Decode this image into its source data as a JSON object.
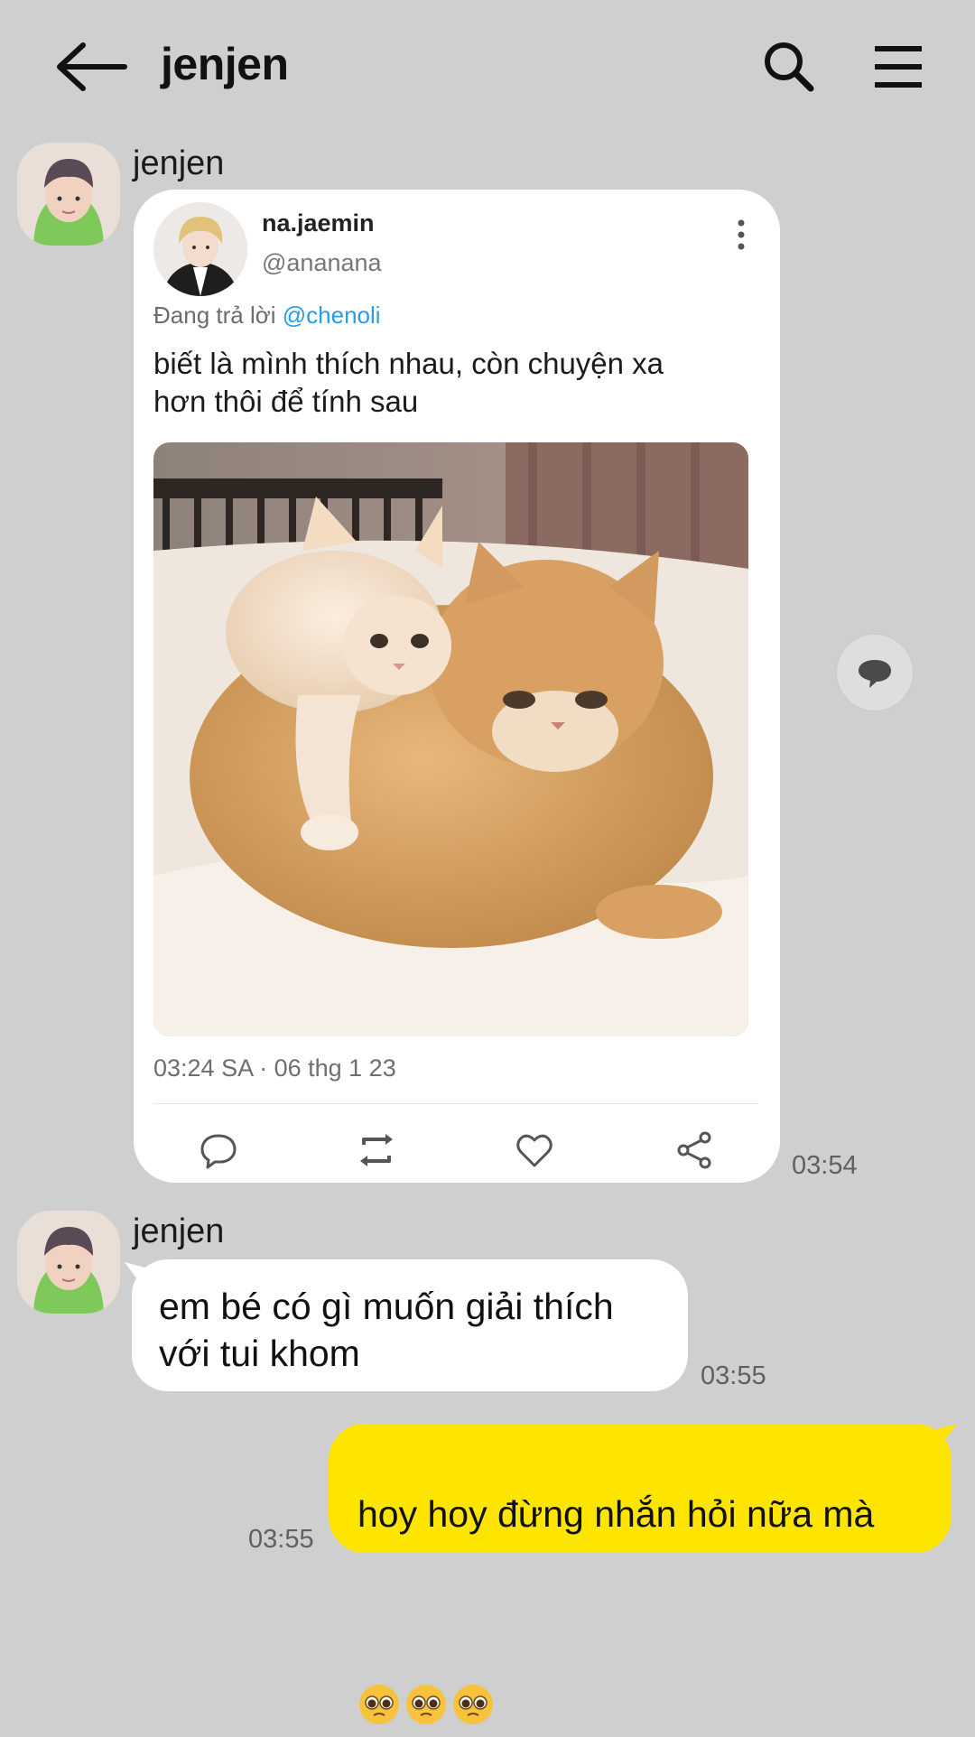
{
  "header": {
    "title": "jenjen",
    "icons": [
      "back-arrow-icon",
      "search-icon",
      "hamburger-menu-icon"
    ]
  },
  "messages": [
    {
      "sender": "jenjen",
      "time": "03:54",
      "tweet": {
        "name": "na.jaemin",
        "handle": "@ananana",
        "reply_prefix": "Đang trả lời ",
        "reply_to": "@chenoli",
        "text_line1": "biết là mình thích nhau, còn chuyện xa",
        "text_line2": "hơn thôi để tính sau",
        "timestamp": "03:24 SA · 06 thg 1 23",
        "actions": [
          "reply-icon",
          "retweet-icon",
          "like-icon",
          "share-icon"
        ]
      }
    },
    {
      "sender": "jenjen",
      "time": "03:55",
      "text_line1": "em bé có gì muốn giải thích",
      "text_line2": "với tui khom"
    },
    {
      "sender": "me",
      "time": "03:55",
      "text": "hoy hoy đừng nhắn hỏi nữa mà",
      "emoji": [
        "pleading-face-emoji",
        "pleading-face-emoji",
        "pleading-face-emoji"
      ]
    }
  ],
  "colors": {
    "background": "#cfcfcf",
    "my_bubble": "#fee500",
    "their_bubble": "#ffffff",
    "mention": "#2a9be8"
  }
}
